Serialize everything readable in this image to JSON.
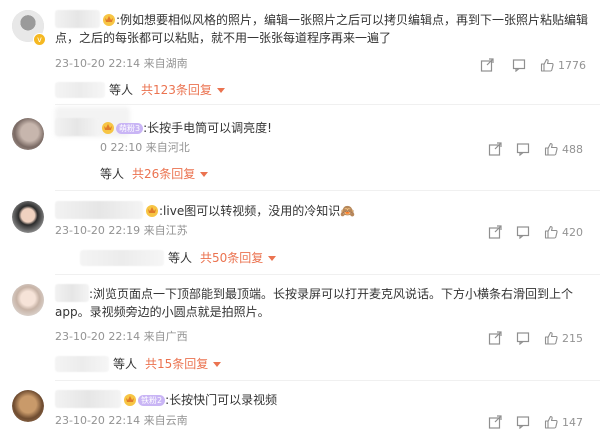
{
  "comments": [
    {
      "text": ":例如想要相似风格的照片，编辑一张照片之后可以拷贝编辑点，再到下一张照片粘贴编辑点，之后的每张都可以粘贴，就不用一张张每道程序再来一遍了",
      "meta": "23-10-20 22:14 来自湖南",
      "likes": "1776",
      "replies_prefix": "等人",
      "replies_count": "共123条回复"
    },
    {
      "text": ":长按手电筒可以调亮度!",
      "badge": "萌粉3",
      "meta": "0 22:10 来自河北",
      "likes": "488",
      "replies_prefix": "等人",
      "replies_count": "共26条回复"
    },
    {
      "text": ":live图可以转视频，没用的冷知识🙈",
      "meta": "23-10-20 22:19 来自江苏",
      "likes": "420",
      "replies_prefix": "等人",
      "replies_count": "共50条回复"
    },
    {
      "text": ":浏览页面点一下顶部能到最顶端。长按录屏可以打开麦克风说话。下方小横条右滑回到上个app。录视频旁边的小圆点就是拍照片。",
      "meta": "23-10-20 22:14 来自广西",
      "likes": "215",
      "replies_prefix": "等人",
      "replies_count": "共15条回复"
    },
    {
      "text": ":长按快门可以录视频",
      "badge": "铁粉2",
      "meta": "23-10-20 22:14 来自云南",
      "likes": "147"
    }
  ],
  "icons": {
    "share": "share-icon",
    "comment": "comment-icon",
    "like": "thumbs-up-icon"
  },
  "colors": {
    "reply_accent": "#eb7350",
    "meta_gray": "#939393"
  }
}
